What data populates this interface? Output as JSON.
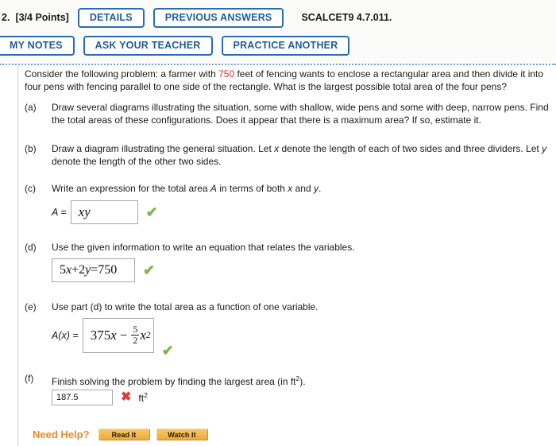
{
  "header": {
    "question_number": "2.",
    "points": "[3/4 Points]",
    "details_label": "DETAILS",
    "previous_answers_label": "PREVIOUS ANSWERS",
    "assignment_code": "SCALCET9 4.7.011.",
    "my_notes_label": "MY NOTES",
    "ask_your_teacher_label": "ASK YOUR TEACHER",
    "practice_another_label": "PRACTICE ANOTHER",
    "button_border_color": "#2b6cb0",
    "button_text_color": "#1f5c99"
  },
  "problem": {
    "text_before_value": "Consider the following problem: a farmer with ",
    "highlighted_value": "750",
    "text_after_value": " feet of fencing wants to enclose a rectangular area and then divide it into four pens with fencing parallel to one side of the rectangle. What is the largest possible total area of the four pens?",
    "highlight_color": "#d7322c"
  },
  "parts": {
    "a": {
      "label": "(a)",
      "text": "Draw several diagrams illustrating the situation, some with shallow, wide pens and some with deep, narrow pens. Find the total areas of these configurations. Does it appear that there is a maximum area? If so, estimate it."
    },
    "b": {
      "label": "(b)",
      "text_1": "Draw a diagram illustrating the general situation. Let ",
      "var_x": "x",
      "text_2": " denote the length of each of two sides and three dividers. Let ",
      "var_y": "y",
      "text_3": " denote the length of the other two sides."
    },
    "c": {
      "label": "(c)",
      "text_1": "Write an expression for the total area ",
      "var_A": "A",
      "text_2": " in terms of both ",
      "var_x": "x",
      "text_3": " and ",
      "var_y": "y",
      "text_4": ".",
      "answer_prefix": "A =",
      "answer_value": "xy",
      "status_icon": "green-check-icon",
      "status_mark": "✔",
      "status_color": "#7ab648"
    },
    "d": {
      "label": "(d)",
      "text": "Use the given information to write an equation that relates the variables.",
      "answer_lhs_coeff": "5",
      "answer_lhs_var": "x",
      "answer_operator": " + ",
      "answer_rhs_coeff": "2",
      "answer_rhs_var": "y",
      "answer_equals": " = ",
      "answer_constant": "750",
      "answer_value_full": "5x + 2y = 750",
      "status_icon": "green-check-icon",
      "status_mark": "✔",
      "status_color": "#7ab648"
    },
    "e": {
      "label": "(e)",
      "text": "Use part (d) to write the total area as a function of one variable.",
      "answer_prefix": "A(x) =",
      "answer_term_1": "375",
      "answer_term_1_var": "x",
      "answer_minus": "−",
      "answer_frac_num": "5",
      "answer_frac_den": "2",
      "answer_term_2_var": "x",
      "answer_term_2_exp": "2",
      "answer_value_full": "375x − (5/2)x²",
      "status_icon": "green-check-icon",
      "status_mark": "✔",
      "status_color": "#7ab648"
    },
    "f": {
      "label": "(f)",
      "text_1": "Finish solving the problem by finding the largest area (in ft",
      "text_exp": "2",
      "text_2": ").",
      "answer_value": "187.5",
      "answer_placeholder": "",
      "unit": "ft",
      "unit_exp": "2",
      "status_icon": "red-x-icon",
      "status_mark": "✖",
      "status_color": "#e03a3a"
    }
  },
  "need_help": {
    "label": "Need Help?",
    "label_color": "#e8892b",
    "read_it_label": "Read It",
    "watch_it_label": "Watch It"
  }
}
